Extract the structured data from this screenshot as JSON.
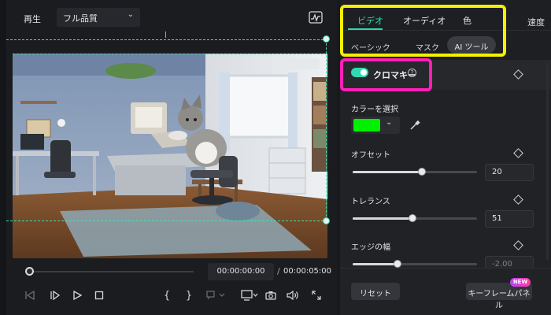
{
  "preview": {
    "play_label": "再生",
    "quality": "フル品質",
    "current_time": "00:00:00:00",
    "time_separator": "/",
    "total_time": "00:00:05:00",
    "playback_progress": 0
  },
  "inspector": {
    "tabs": [
      "ビデオ",
      "オーディオ",
      "色",
      "速度"
    ],
    "active_tab": "ビデオ",
    "subtabs": [
      "ベーシック",
      "マスク",
      "AI ツール"
    ],
    "active_subtab": "AI ツール",
    "section_title": "クロマキー",
    "section_enabled": true,
    "color_label": "カラーを選択",
    "selected_color": "#00f000",
    "params": [
      {
        "label": "オフセット",
        "value": "20",
        "fraction": 0.56
      },
      {
        "label": "トレランス",
        "value": "51",
        "fraction": 0.48
      },
      {
        "label": "エッジの幅",
        "value": "-2.00",
        "fraction": 0.36
      }
    ],
    "reset_label": "リセット",
    "keyframe_label": "キーフレームパネル",
    "new_badge": "NEW"
  },
  "colors": {
    "accent": "#2fd8b0",
    "highlight_tabs": "#f3f000",
    "highlight_chroma": "#ff1fb8"
  }
}
